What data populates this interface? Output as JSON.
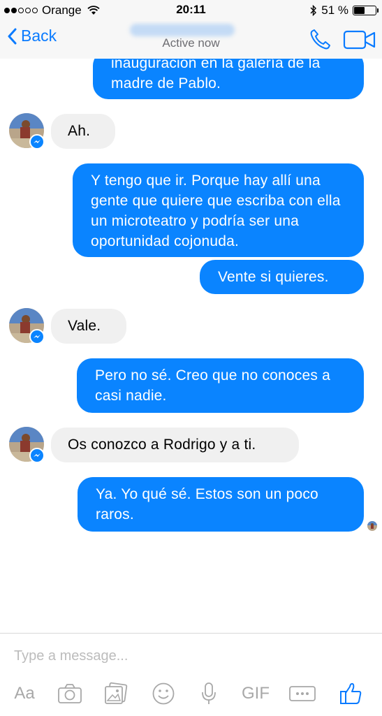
{
  "status_bar": {
    "carrier": "Orange",
    "time": "20:11",
    "battery_text": "51 %",
    "battery_level": 0.51
  },
  "header": {
    "back_label": "Back",
    "status": "Active now"
  },
  "messages": [
    {
      "from": "me",
      "text": "inauguración en la galería de la madre de Pablo."
    },
    {
      "from": "them",
      "text": "Ah."
    },
    {
      "from": "me",
      "text": "Y tengo que ir. Porque hay allí una gente que quiere que escriba con ella un microteatro y podría ser una oportunidad cojonuda."
    },
    {
      "from": "me",
      "text": "Vente si quieres."
    },
    {
      "from": "them",
      "text": "Vale."
    },
    {
      "from": "me",
      "text": "Pero no sé. Creo que no conoces a casi nadie."
    },
    {
      "from": "them",
      "text": "Os conozco a Rodrigo y a ti."
    },
    {
      "from": "me",
      "text": "Ya. Yo qué sé. Estos son un poco raros."
    }
  ],
  "composer": {
    "placeholder": "Type a message...",
    "tools": {
      "aa": "Aa",
      "gif": "GIF"
    }
  },
  "icons": [
    "chevron-left-icon",
    "phone-icon",
    "video-camera-icon",
    "camera-icon",
    "gallery-icon",
    "emoji-icon",
    "microphone-icon",
    "more-icon",
    "like-icon",
    "messenger-badge-icon",
    "wifi-icon",
    "bluetooth-icon",
    "battery-icon"
  ],
  "colors": {
    "accent": "#0a7bff",
    "outgoing_bubble": "#0a84ff",
    "incoming_bubble": "#f0f0f0"
  }
}
